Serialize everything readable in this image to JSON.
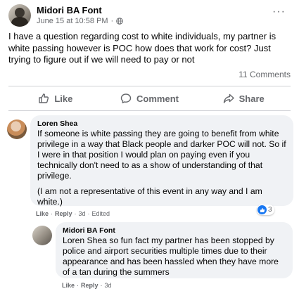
{
  "post": {
    "author": "Midori BA Font",
    "timestamp": "June 15 at 10:58 PM",
    "text": "I have a question regarding cost to white individuals, my partner is white passing however is POC how does that work for cost? Just trying to figure out if we will need to pay or not",
    "comments_count": "11 Comments",
    "more_icon": "···"
  },
  "actions": {
    "like": "Like",
    "comment": "Comment",
    "share": "Share"
  },
  "comments": [
    {
      "author": "Loren Shea",
      "paragraph1": "If someone is white passing they are going to benefit from white privilege in a way that Black people and darker POC will not. So if I were in that position I would plan on paying even if you technically don't need to as a show of understanding of that privilege.",
      "paragraph2": "(I am not a representative of this event in any way and I am white.)",
      "like_label": "Like",
      "reply_label": "Reply",
      "age": "3d",
      "edited": "Edited",
      "reaction_count": "3"
    },
    {
      "author": "Midori BA Font",
      "text": "Loren Shea so fun fact my partner has been stopped by police and airport securities multiple times due to their appearance and has been hassled when they have more of a tan during the summers",
      "like_label": "Like",
      "reply_label": "Reply",
      "age": "3d"
    }
  ],
  "colors": {
    "accent": "#1877f2",
    "secondary_text": "#65676b",
    "bubble": "#f0f2f5"
  }
}
